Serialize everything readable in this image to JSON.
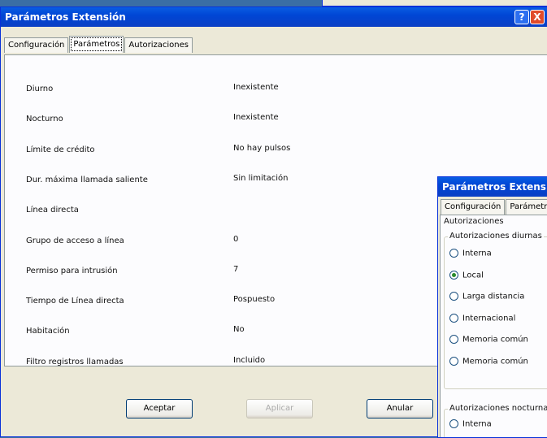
{
  "main_window": {
    "title": "Parámetros Extensión",
    "help_label": "?",
    "close_label": "X",
    "tabs": [
      {
        "label": "Configuración"
      },
      {
        "label": "Parámetros",
        "active": true
      },
      {
        "label": "Autorizaciones"
      }
    ],
    "rows": [
      {
        "label": "Diurno",
        "value": "Inexistente"
      },
      {
        "label": "Nocturno",
        "value": "Inexistente"
      },
      {
        "label": "Límite de crédito",
        "value": "No hay pulsos"
      },
      {
        "label": "Dur. máxima llamada saliente",
        "value": "Sin limitación"
      },
      {
        "label": "Línea directa",
        "value": ""
      },
      {
        "label": "Grupo de acceso a línea",
        "value": "0"
      },
      {
        "label": "Permiso para intrusión",
        "value": "7"
      },
      {
        "label": "Tiempo de Línea directa",
        "value": "Pospuesto"
      },
      {
        "label": "Habitación",
        "value": "No"
      },
      {
        "label": "Filtro registros llamadas",
        "value": "Incluido"
      }
    ],
    "buttons": {
      "accept": "Aceptar",
      "apply": "Aplicar",
      "cancel": "Anular"
    }
  },
  "second_window": {
    "title": "Parámetros Extensión",
    "tabs": [
      {
        "label": "Configuración"
      },
      {
        "label": "Parámetros"
      }
    ],
    "section_title": "Autorizaciones",
    "day_group": {
      "title": "Autorizaciones diurnas",
      "options": [
        {
          "label": "Interna",
          "selected": false
        },
        {
          "label": "Local",
          "selected": true
        },
        {
          "label": "Larga distancia",
          "selected": false
        },
        {
          "label": "Internacional",
          "selected": false
        },
        {
          "label": "Memoria común",
          "selected": false
        },
        {
          "label": "Memoria común",
          "selected": false
        }
      ]
    },
    "night_group": {
      "title": "Autorizaciones nocturnas",
      "options": [
        {
          "label": "Interna",
          "selected": false
        }
      ]
    }
  }
}
